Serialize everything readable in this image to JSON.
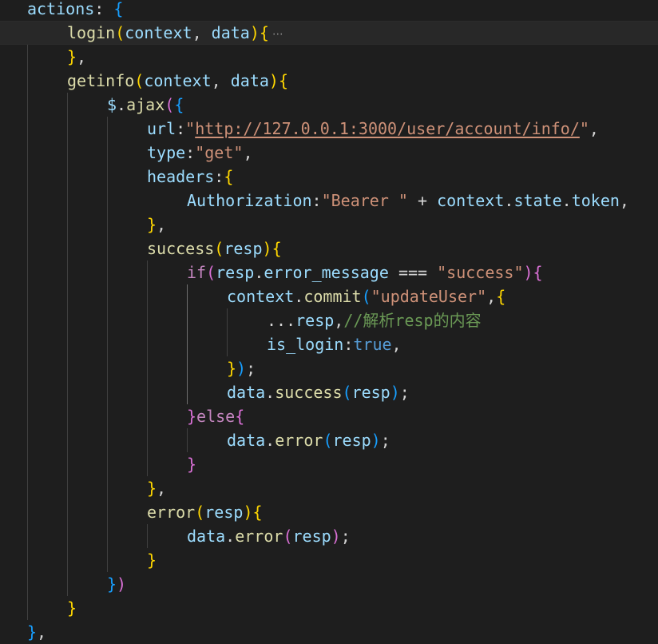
{
  "colors": {
    "background": "#1e1e1e",
    "current_line": "#282828",
    "indent_guide": "#404040",
    "indent_guide_active": "#707070",
    "plain": "#d4d4d4",
    "variable": "#9cdcfe",
    "function": "#dcdcaa",
    "string": "#ce9178",
    "keyword": "#c586c0",
    "constant": "#569cd6",
    "comment": "#6a9955",
    "bracket_gold": "#ffd700",
    "bracket_purple": "#da70d6",
    "bracket_blue": "#179fff"
  },
  "code_lines": [
    {
      "indent": 0,
      "tokens": [
        {
          "t": "actions",
          "c": "variable"
        },
        {
          "t": ": ",
          "c": "plain"
        },
        {
          "t": "{",
          "c": "bracket_blue"
        }
      ]
    },
    {
      "indent": 1,
      "folded": true,
      "fold_icon": "ellipsis-icon",
      "current": true,
      "tokens": [
        {
          "t": "login",
          "c": "function"
        },
        {
          "t": "(",
          "c": "bracket_gold"
        },
        {
          "t": "context",
          "c": "variable"
        },
        {
          "t": ", ",
          "c": "plain"
        },
        {
          "t": "data",
          "c": "variable"
        },
        {
          "t": ")",
          "c": "bracket_gold"
        },
        {
          "t": "{",
          "c": "bracket_gold"
        }
      ]
    },
    {
      "indent": 1,
      "tokens": [
        {
          "t": "}",
          "c": "bracket_gold"
        },
        {
          "t": ",",
          "c": "plain"
        }
      ]
    },
    {
      "indent": 1,
      "tokens": [
        {
          "t": "getinfo",
          "c": "function"
        },
        {
          "t": "(",
          "c": "bracket_gold"
        },
        {
          "t": "context",
          "c": "variable"
        },
        {
          "t": ", ",
          "c": "plain"
        },
        {
          "t": "data",
          "c": "variable"
        },
        {
          "t": ")",
          "c": "bracket_gold"
        },
        {
          "t": "{",
          "c": "bracket_gold"
        }
      ]
    },
    {
      "indent": 2,
      "tokens": [
        {
          "t": "$",
          "c": "variable"
        },
        {
          "t": ".",
          "c": "plain"
        },
        {
          "t": "ajax",
          "c": "function"
        },
        {
          "t": "(",
          "c": "bracket_purple"
        },
        {
          "t": "{",
          "c": "bracket_blue"
        }
      ]
    },
    {
      "indent": 3,
      "tokens": [
        {
          "t": "url",
          "c": "variable"
        },
        {
          "t": ":",
          "c": "plain"
        },
        {
          "t": "\"",
          "c": "string"
        },
        {
          "t": "http://127.0.0.1:3000/user/account/info/",
          "c": "string",
          "link": true
        },
        {
          "t": "\"",
          "c": "string"
        },
        {
          "t": ",",
          "c": "plain"
        }
      ]
    },
    {
      "indent": 3,
      "tokens": [
        {
          "t": "type",
          "c": "variable"
        },
        {
          "t": ":",
          "c": "plain"
        },
        {
          "t": "\"get\"",
          "c": "string"
        },
        {
          "t": ",",
          "c": "plain"
        }
      ]
    },
    {
      "indent": 3,
      "tokens": [
        {
          "t": "headers",
          "c": "variable"
        },
        {
          "t": ":",
          "c": "plain"
        },
        {
          "t": "{",
          "c": "bracket_gold"
        }
      ]
    },
    {
      "indent": 4,
      "tokens": [
        {
          "t": "Authorization",
          "c": "variable"
        },
        {
          "t": ":",
          "c": "plain"
        },
        {
          "t": "\"Bearer \"",
          "c": "string"
        },
        {
          "t": " + ",
          "c": "plain"
        },
        {
          "t": "context",
          "c": "variable"
        },
        {
          "t": ".",
          "c": "plain"
        },
        {
          "t": "state",
          "c": "variable"
        },
        {
          "t": ".",
          "c": "plain"
        },
        {
          "t": "token",
          "c": "variable"
        },
        {
          "t": ",",
          "c": "plain"
        }
      ]
    },
    {
      "indent": 3,
      "tokens": [
        {
          "t": "}",
          "c": "bracket_gold"
        },
        {
          "t": ",",
          "c": "plain"
        }
      ]
    },
    {
      "indent": 3,
      "tokens": [
        {
          "t": "success",
          "c": "function"
        },
        {
          "t": "(",
          "c": "bracket_gold"
        },
        {
          "t": "resp",
          "c": "variable"
        },
        {
          "t": ")",
          "c": "bracket_gold"
        },
        {
          "t": "{",
          "c": "bracket_gold"
        }
      ]
    },
    {
      "indent": 4,
      "tokens": [
        {
          "t": "if",
          "c": "keyword"
        },
        {
          "t": "(",
          "c": "bracket_purple"
        },
        {
          "t": "resp",
          "c": "variable"
        },
        {
          "t": ".",
          "c": "plain"
        },
        {
          "t": "error_message",
          "c": "variable"
        },
        {
          "t": " === ",
          "c": "plain"
        },
        {
          "t": "\"success\"",
          "c": "string"
        },
        {
          "t": ")",
          "c": "bracket_purple"
        },
        {
          "t": "{",
          "c": "bracket_purple"
        }
      ]
    },
    {
      "indent": 5,
      "tokens": [
        {
          "t": "context",
          "c": "variable"
        },
        {
          "t": ".",
          "c": "plain"
        },
        {
          "t": "commit",
          "c": "function"
        },
        {
          "t": "(",
          "c": "bracket_blue"
        },
        {
          "t": "\"updateUser\"",
          "c": "string"
        },
        {
          "t": ",",
          "c": "plain"
        },
        {
          "t": "{",
          "c": "bracket_gold"
        }
      ]
    },
    {
      "indent": 6,
      "tokens": [
        {
          "t": "...",
          "c": "plain"
        },
        {
          "t": "resp",
          "c": "variable"
        },
        {
          "t": ",",
          "c": "plain"
        },
        {
          "t": "//解析resp的内容",
          "c": "comment"
        }
      ]
    },
    {
      "indent": 6,
      "tokens": [
        {
          "t": "is_login",
          "c": "variable"
        },
        {
          "t": ":",
          "c": "plain"
        },
        {
          "t": "true",
          "c": "constant"
        },
        {
          "t": ",",
          "c": "plain"
        }
      ]
    },
    {
      "indent": 5,
      "tokens": [
        {
          "t": "}",
          "c": "bracket_gold"
        },
        {
          "t": ")",
          "c": "bracket_blue"
        },
        {
          "t": ";",
          "c": "plain"
        }
      ]
    },
    {
      "indent": 5,
      "tokens": [
        {
          "t": "data",
          "c": "variable"
        },
        {
          "t": ".",
          "c": "plain"
        },
        {
          "t": "success",
          "c": "function"
        },
        {
          "t": "(",
          "c": "bracket_blue"
        },
        {
          "t": "resp",
          "c": "variable"
        },
        {
          "t": ")",
          "c": "bracket_blue"
        },
        {
          "t": ";",
          "c": "plain"
        }
      ]
    },
    {
      "indent": 4,
      "tokens": [
        {
          "t": "}",
          "c": "bracket_purple"
        },
        {
          "t": "else",
          "c": "keyword"
        },
        {
          "t": "{",
          "c": "bracket_purple"
        }
      ]
    },
    {
      "indent": 5,
      "tokens": [
        {
          "t": "data",
          "c": "variable"
        },
        {
          "t": ".",
          "c": "plain"
        },
        {
          "t": "error",
          "c": "function"
        },
        {
          "t": "(",
          "c": "bracket_blue"
        },
        {
          "t": "resp",
          "c": "variable"
        },
        {
          "t": ")",
          "c": "bracket_blue"
        },
        {
          "t": ";",
          "c": "plain"
        }
      ]
    },
    {
      "indent": 4,
      "tokens": [
        {
          "t": "}",
          "c": "bracket_purple"
        }
      ]
    },
    {
      "indent": 3,
      "tokens": [
        {
          "t": "}",
          "c": "bracket_gold"
        },
        {
          "t": ",",
          "c": "plain"
        }
      ]
    },
    {
      "indent": 3,
      "tokens": [
        {
          "t": "error",
          "c": "function"
        },
        {
          "t": "(",
          "c": "bracket_gold"
        },
        {
          "t": "resp",
          "c": "variable"
        },
        {
          "t": ")",
          "c": "bracket_gold"
        },
        {
          "t": "{",
          "c": "bracket_gold"
        }
      ]
    },
    {
      "indent": 4,
      "tokens": [
        {
          "t": "data",
          "c": "variable"
        },
        {
          "t": ".",
          "c": "plain"
        },
        {
          "t": "error",
          "c": "function"
        },
        {
          "t": "(",
          "c": "bracket_purple"
        },
        {
          "t": "resp",
          "c": "variable"
        },
        {
          "t": ")",
          "c": "bracket_purple"
        },
        {
          "t": ";",
          "c": "plain"
        }
      ]
    },
    {
      "indent": 3,
      "tokens": [
        {
          "t": "}",
          "c": "bracket_gold"
        }
      ]
    },
    {
      "indent": 2,
      "tokens": [
        {
          "t": "}",
          "c": "bracket_blue"
        },
        {
          "t": ")",
          "c": "bracket_purple"
        }
      ]
    },
    {
      "indent": 1,
      "tokens": [
        {
          "t": "}",
          "c": "bracket_gold"
        }
      ]
    },
    {
      "indent": 0,
      "tokens": [
        {
          "t": "}",
          "c": "bracket_blue"
        },
        {
          "t": ",",
          "c": "plain"
        }
      ]
    }
  ]
}
